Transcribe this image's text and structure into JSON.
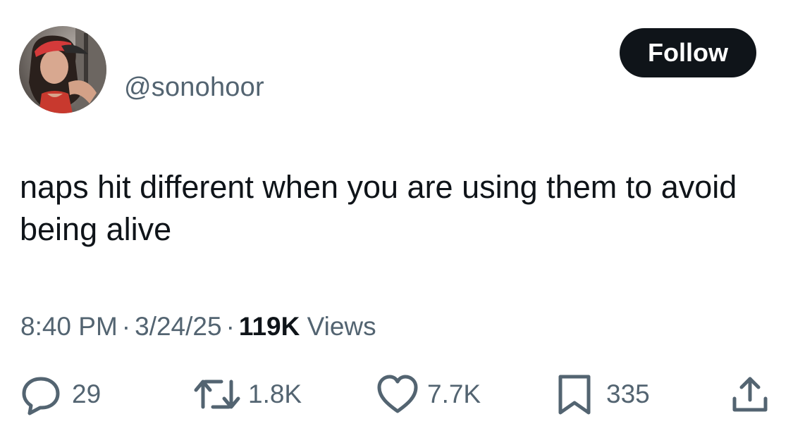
{
  "author": {
    "handle": "@sonohoor",
    "avatar_icon": "profile-photo"
  },
  "follow_button": {
    "label": "Follow",
    "background": "#0f1419",
    "text_color": "#ffffff"
  },
  "tweet": {
    "text": "naps hit different when you are using them to avoid being alive"
  },
  "meta": {
    "time": "8:40 PM",
    "separator": "·",
    "date": "3/24/25",
    "views_count": "119K",
    "views_label": "Views"
  },
  "actions": {
    "reply": {
      "icon": "reply-icon",
      "count": "29"
    },
    "retweet": {
      "icon": "retweet-icon",
      "count": "1.8K"
    },
    "like": {
      "icon": "heart-icon",
      "count": "7.7K"
    },
    "bookmark": {
      "icon": "bookmark-icon",
      "count": "335"
    },
    "share": {
      "icon": "share-icon"
    }
  },
  "colors": {
    "primary_text": "#0f1419",
    "secondary_text": "#536471",
    "background": "#ffffff"
  }
}
